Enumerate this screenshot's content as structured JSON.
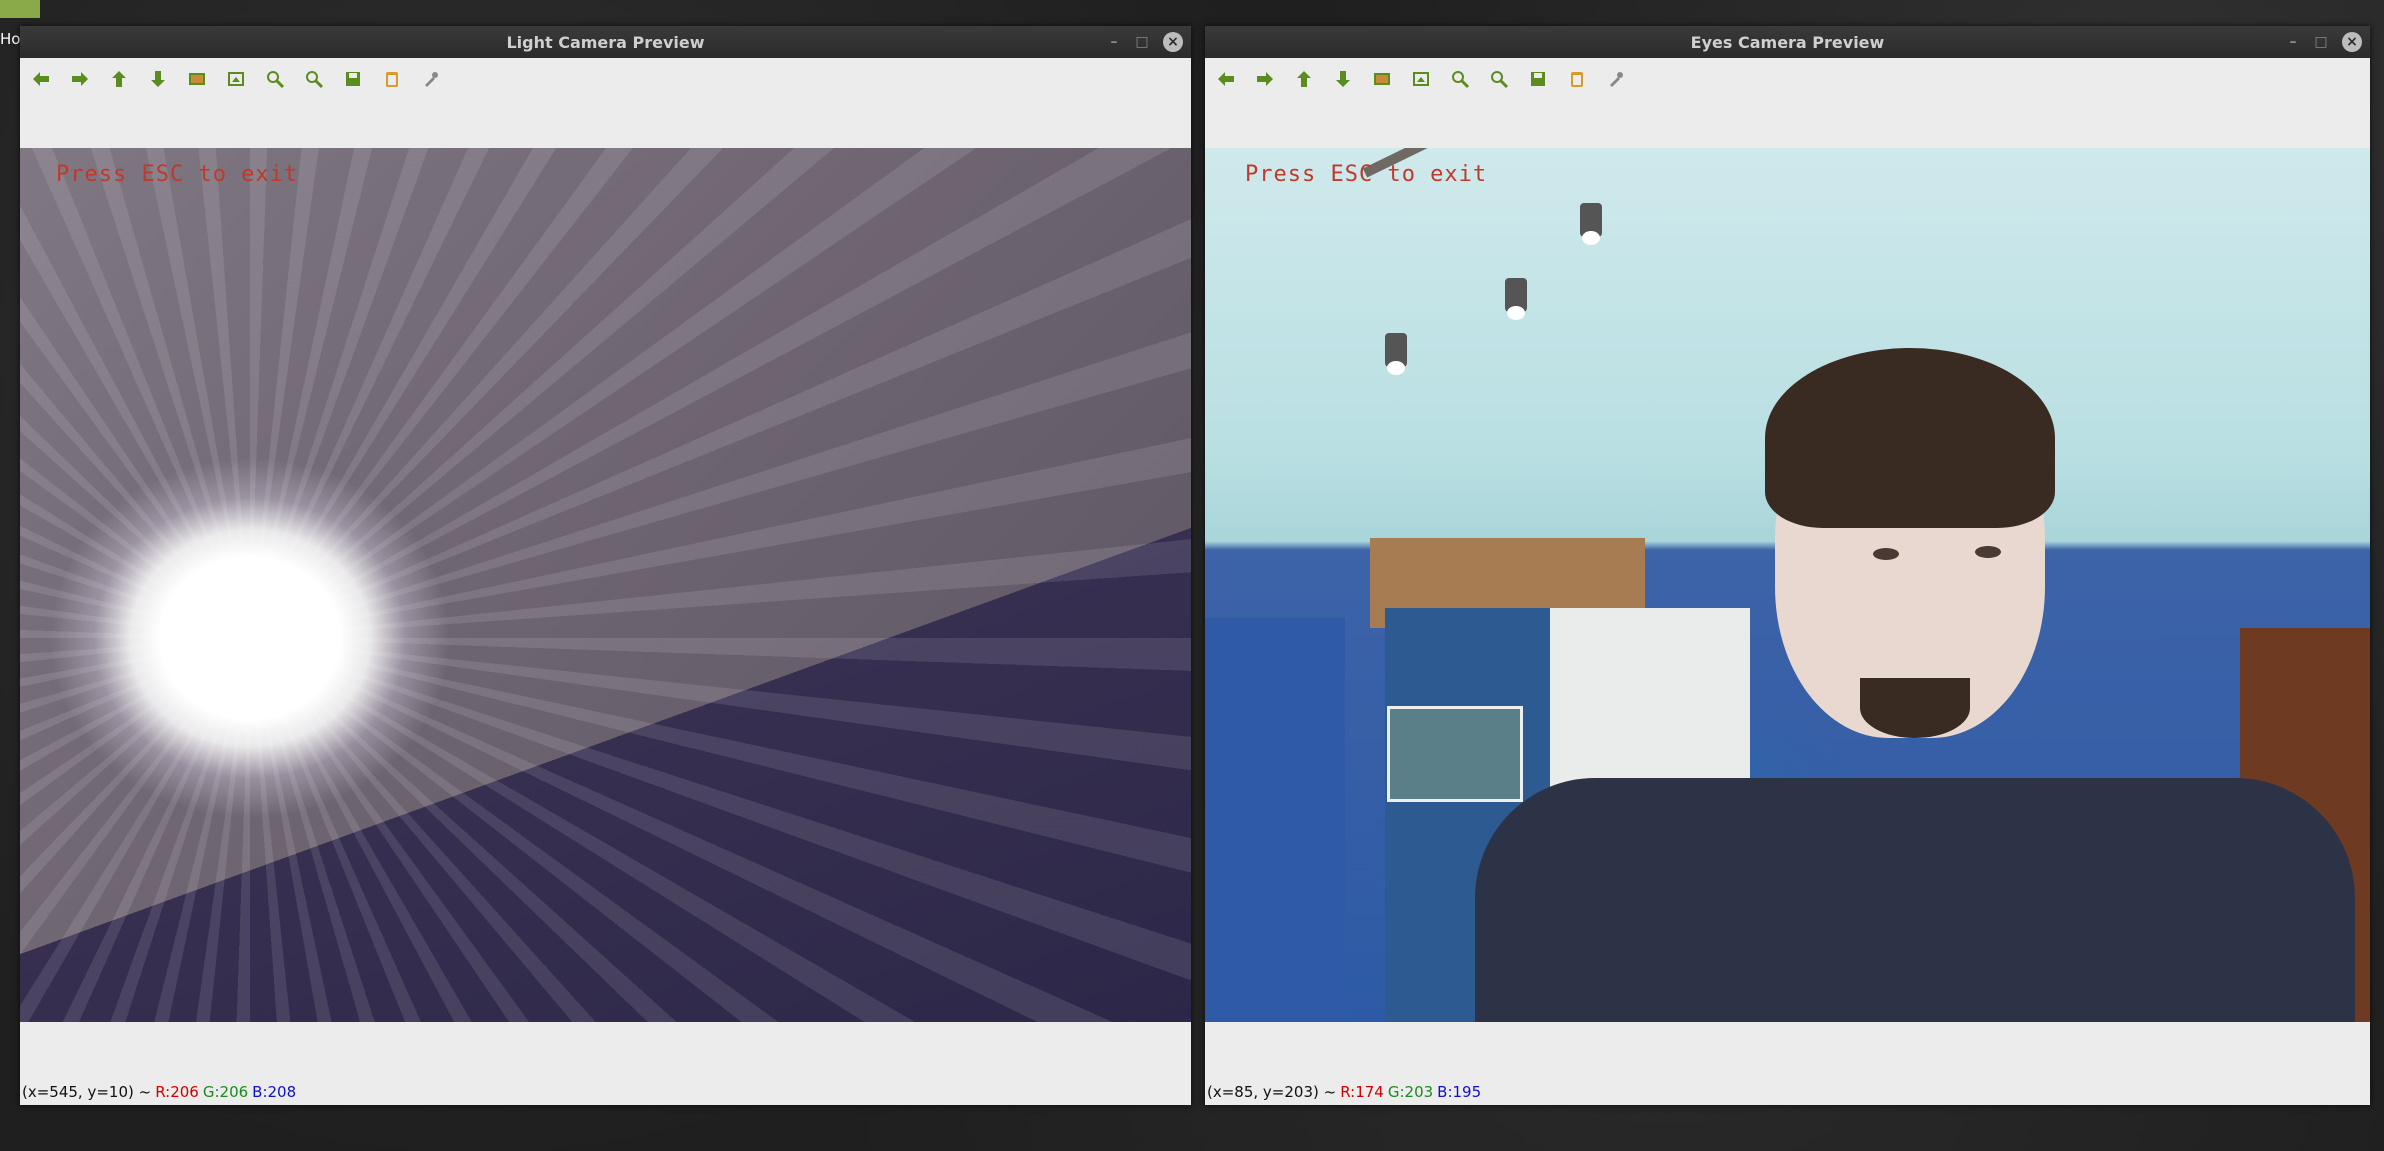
{
  "desktop": {
    "label": "Ho"
  },
  "windows": [
    {
      "title": "Light Camera Preview",
      "overlay": "Press ESC to exit",
      "status": {
        "coords": "(x=545, y=10) ~",
        "r": "R:206",
        "g": "G:206",
        "b": "B:208"
      }
    },
    {
      "title": "Eyes Camera Preview",
      "overlay": "Press ESC to exit",
      "status": {
        "coords": "(x=85, y=203) ~",
        "r": "R:174",
        "g": "G:203",
        "b": "B:195"
      }
    }
  ],
  "window_controls": {
    "minimize": "–",
    "maximize": "□",
    "close": "×"
  },
  "toolbar_icons": [
    "arrow-left-icon",
    "arrow-right-icon",
    "arrow-up-icon",
    "arrow-down-icon",
    "image-icon",
    "fit-icon",
    "zoom-in-icon",
    "zoom-out-icon",
    "save-icon",
    "copy-icon",
    "properties-icon"
  ],
  "colors": {
    "icon_green": "#5a8c1e",
    "status_red": "#d00000",
    "status_green": "#1d8a1d",
    "status_blue": "#1010c8",
    "overlay_red": "#c0392b"
  }
}
